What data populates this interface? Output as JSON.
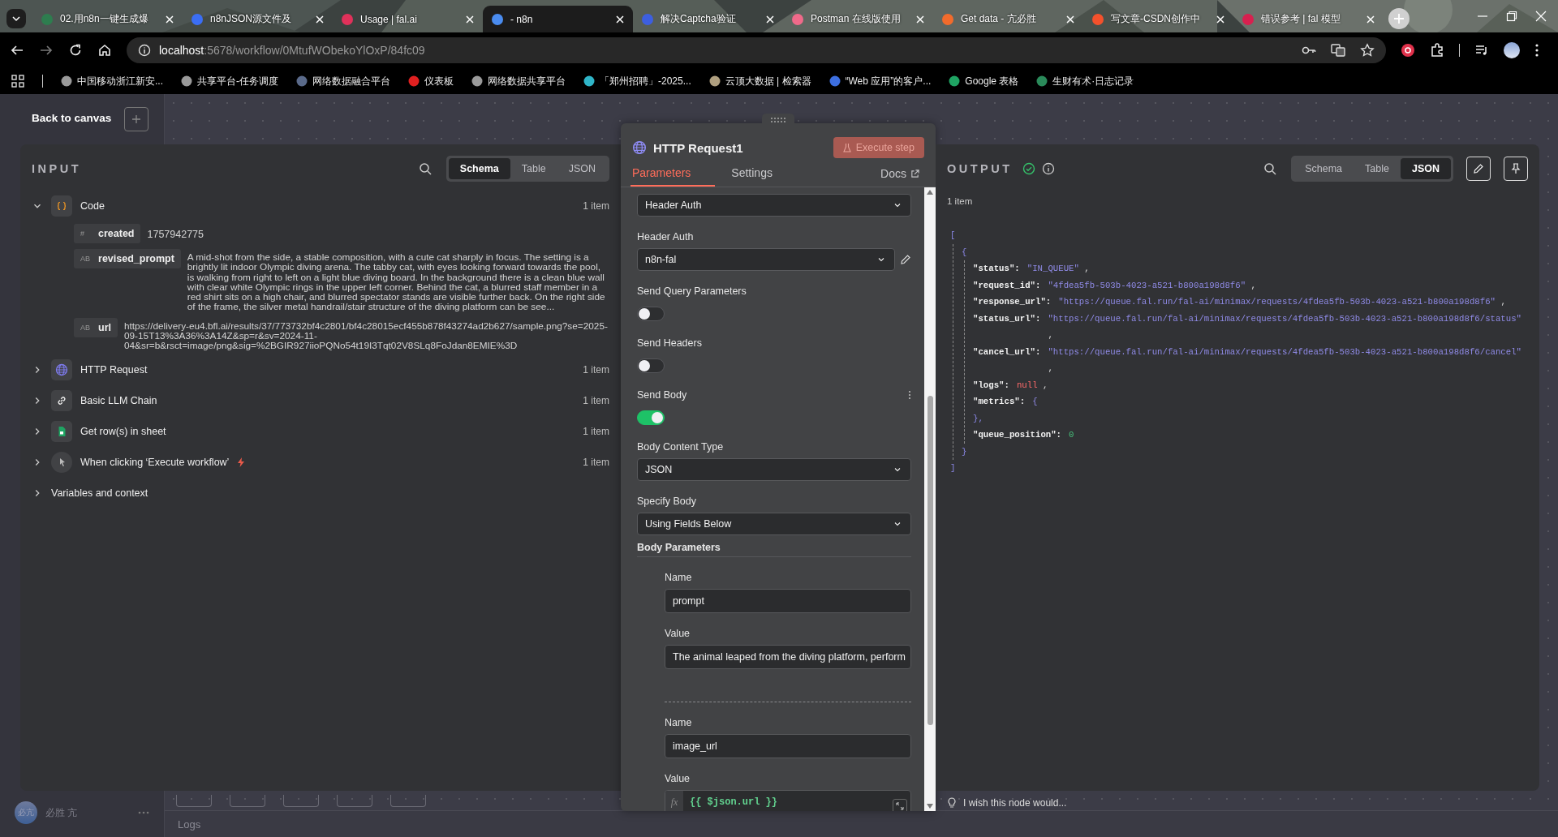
{
  "browser": {
    "tabs": [
      {
        "title": "02.用n8n一键生成爆",
        "selected": false,
        "color": "#2e7d4f"
      },
      {
        "title": "n8nJSON源文件及",
        "selected": false,
        "color": "#3b6ef5"
      },
      {
        "title": "Usage | fal.ai",
        "selected": false,
        "color": "#e0315a"
      },
      {
        "title": "- n8n",
        "selected": true,
        "color": "#4a8cf0"
      },
      {
        "title": "解决Captcha验证",
        "selected": false,
        "color": "#3d5fe0"
      },
      {
        "title": "Postman 在线版使用",
        "selected": false,
        "color": "#f06a8a"
      },
      {
        "title": "Get data - 亢必胜",
        "selected": false,
        "color": "#f26b2c"
      },
      {
        "title": "写文章-CSDN创作中",
        "selected": false,
        "color": "#f4512c"
      },
      {
        "title": "错误参考 | fal 模型",
        "selected": false,
        "color": "#d8204f"
      }
    ],
    "address": {
      "host": "localhost",
      "rest": ":5678/workflow/0MtufWObekoYlOxP/84fc09"
    },
    "bookmarks": [
      {
        "label": "中国移动浙江新安...",
        "color": "#9a9a9a"
      },
      {
        "label": "共享平台-任务调度",
        "color": "#9a9a9a"
      },
      {
        "label": "网络数据融合平台",
        "color": "#5a6a8a"
      },
      {
        "label": "仪表板",
        "color": "#e02020"
      },
      {
        "label": "网络数据共享平台",
        "color": "#9a9a9a"
      },
      {
        "label": "「郑州招聘」-2025...",
        "color": "#2fb5c8"
      },
      {
        "label": "云顶大数据 | 检索器",
        "color": "#b0a080"
      },
      {
        "label": "“Web 应用”的客户...",
        "color": "#3d6fe0"
      },
      {
        "label": "Google 表格",
        "color": "#1fa463"
      },
      {
        "label": "生财有术·日志记录",
        "color": "#2a8a5a"
      }
    ]
  },
  "back": "Back to canvas",
  "input": {
    "title": "INPUT",
    "views": [
      {
        "label": "Schema",
        "selected": true
      },
      {
        "label": "Table",
        "selected": false
      },
      {
        "label": "JSON",
        "selected": false
      }
    ],
    "nodes": [
      {
        "name": "Code",
        "kind": "code",
        "count": "1 item",
        "expanded": true,
        "fields": [
          {
            "type": "#",
            "key": "created",
            "value": "1757942775"
          },
          {
            "type": "AB",
            "key": "revised_prompt",
            "value": "A mid-shot from the side, a stable composition, with a cute cat sharply in focus. The setting is a brightly lit indoor Olympic diving arena. The tabby cat, with eyes looking forward towards the pool, is walking from right to left on a light blue diving board. In the background there is a clean blue wall with clear white Olympic rings in the upper left corner. Behind the cat, a blurred staff member in a red shirt sits on a high chair, and blurred spectator stands are visible further back. On the right side of the frame, the silver metal handrail/stair structure of the diving platform can be see..."
          },
          {
            "type": "AB",
            "key": "url",
            "value": "https://delivery-eu4.bfl.ai/results/37/773732bf4c2801/bf4c28015ecf455b878f43274ad2b627/sample.png?se=2025-09-15T13%3A36%3A14Z&sp=r&sv=2024-11-04&sr=b&rsct=image/png&sig=%2BGIR927iioPQNo54t19I3Tqt02V8SLq8FoJdan8EMIE%3D"
          }
        ]
      },
      {
        "name": "HTTP Request",
        "kind": "http",
        "count": "1 item",
        "expanded": false
      },
      {
        "name": "Basic LLM Chain",
        "kind": "chain",
        "count": "1 item",
        "expanded": false
      },
      {
        "name": "Get row(s) in sheet",
        "kind": "sheet",
        "count": "1 item",
        "expanded": false
      },
      {
        "name": "When clicking ‘Execute workflow’",
        "kind": "trigger",
        "count": "1 item",
        "expanded": false
      }
    ],
    "variables": {
      "label": "Variables and context",
      "expanded": false
    }
  },
  "node": {
    "title": "HTTP Request1",
    "execute": {
      "label": "Execute step",
      "disabled": true
    },
    "tabs": [
      {
        "label": "Parameters",
        "selected": true
      },
      {
        "label": "Settings",
        "selected": false
      }
    ],
    "docs": "Docs",
    "params": [
      {
        "kind": "select",
        "value": "Header Auth"
      },
      {
        "kind": "select",
        "label": "Header Auth",
        "value": "n8n-fal",
        "editable": true
      },
      {
        "kind": "toggle",
        "label": "Send Query Parameters",
        "on": false
      },
      {
        "kind": "toggle",
        "label": "Send Headers",
        "on": false
      },
      {
        "kind": "toggle",
        "label": "Send Body",
        "on": true
      },
      {
        "kind": "select",
        "label": "Body Content Type",
        "value": "JSON"
      },
      {
        "kind": "select",
        "label": "Specify Body",
        "value": "Using Fields Below"
      },
      {
        "kind": "section",
        "label": "Body Parameters",
        "items": [
          {
            "name_label": "Name",
            "name": "prompt",
            "value_label": "Value",
            "value": "The animal leaped from the diving platform, perform",
            "expression": false
          },
          {
            "name_label": "Name",
            "name": "image_url",
            "value_label": "Value",
            "value": "{{ $json.url }}",
            "expression": true,
            "fx": "fx"
          }
        ]
      }
    ]
  },
  "output": {
    "title": "OUTPUT",
    "views": [
      {
        "label": "Schema",
        "selected": false
      },
      {
        "label": "Table",
        "selected": false
      },
      {
        "label": "JSON",
        "selected": true
      }
    ],
    "count": "1 item",
    "json": {
      "open": "[",
      "close": "]",
      "items": [
        {
          "open": "{",
          "close": "}",
          "entries": [
            {
              "key": "\"status\":",
              "value": "\"IN_QUEUE\"",
              "kind": "string",
              "comma": ","
            },
            {
              "key": "\"request_id\":",
              "value": "\"4fdea5fb-503b-4023-a521-b800a198d8f6\"",
              "kind": "string",
              "comma": ","
            },
            {
              "key": "\"response_url\":",
              "value": "\"https://queue.fal.run/fal-ai/minimax/requests/4fdea5fb-503b-4023-a521-b800a198d8f6\"",
              "kind": "string",
              "comma": ","
            },
            {
              "key": "\"status_url\":",
              "value": "\"https://queue.fal.run/fal-ai/minimax/requests/4fdea5fb-503b-4023-a521-b800a198d8f6/status\"",
              "kind": "string",
              "comma": ","
            },
            {
              "key": "\"cancel_url\":",
              "value": "\"https://queue.fal.run/fal-ai/minimax/requests/4fdea5fb-503b-4023-a521-b800a198d8f6/cancel\"",
              "kind": "string",
              "comma": ","
            },
            {
              "key": "\"logs\":",
              "value": "null",
              "kind": "null",
              "comma": ","
            },
            {
              "key": "\"metrics\":",
              "value": "{",
              "kind": "object",
              "close": "},"
            },
            {
              "key": "\"queue_position\":",
              "value": "0",
              "kind": "number"
            }
          ]
        }
      ]
    },
    "feedback": "I wish this node would..."
  },
  "sidebar": {
    "avatar": "必亢",
    "user": "必胜 亢"
  },
  "logs": "Logs"
}
